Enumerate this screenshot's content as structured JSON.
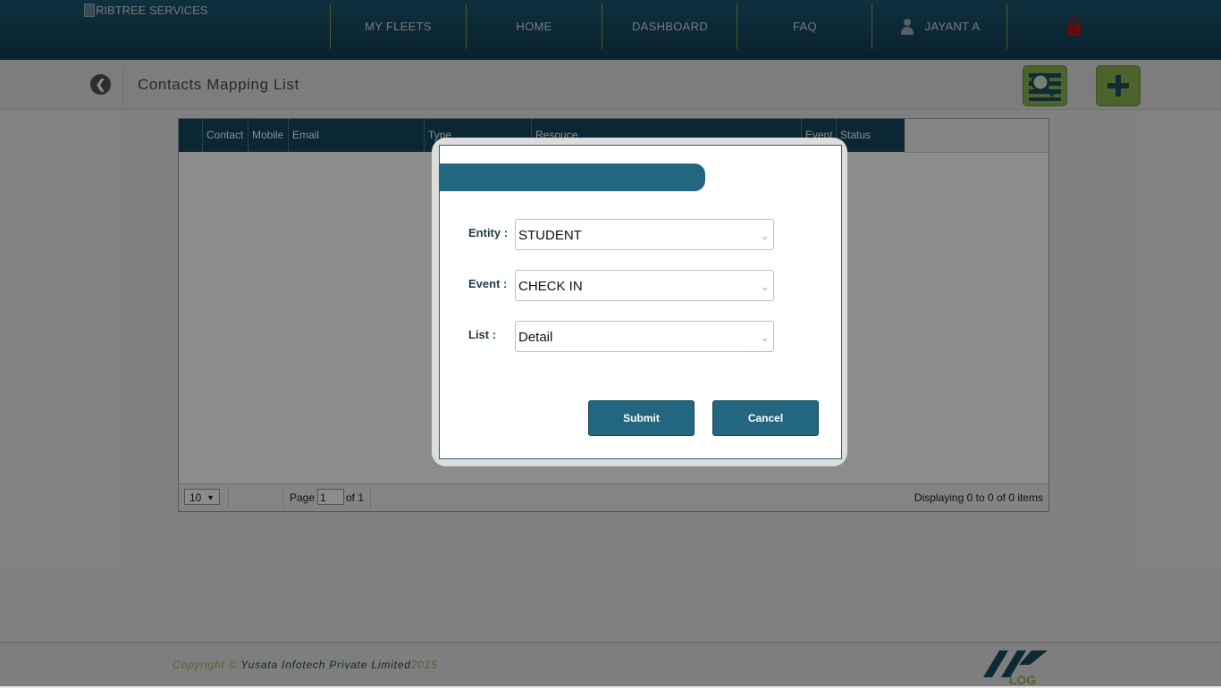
{
  "brand": {
    "logo_alt": "RIBTREE SERVICES"
  },
  "nav": {
    "items": [
      {
        "label": "MY FLEETS"
      },
      {
        "label": "HOME"
      },
      {
        "label": "DASHBOARD"
      },
      {
        "label": "FAQ"
      }
    ],
    "user_name": "JAYANT A"
  },
  "subheader": {
    "title": "Contacts Mapping List"
  },
  "grid": {
    "columns": [
      "Contact",
      "Mobile",
      "Email",
      "Type",
      "Resouce",
      "Event",
      "Status"
    ],
    "rows": [],
    "footer": {
      "page_size": "10",
      "page_label": "Page",
      "page_value": "1",
      "of_label": "of 1",
      "display_text": "Displaying 0 to 0 of 0 items"
    }
  },
  "dialog": {
    "title": "",
    "fields": {
      "entity": {
        "label": "Entity :",
        "value": "STUDENT"
      },
      "event": {
        "label": "Event :",
        "value": "CHECK IN"
      },
      "list": {
        "label": "List :",
        "value": "Detail"
      }
    },
    "submit_label": "Submit",
    "cancel_label": "Cancel"
  },
  "footer": {
    "copyright_prefix": "Copyright ©",
    "company": "Yusata Infotech Private Limited",
    "year": "2015",
    "logo_text": "LOG"
  },
  "colors": {
    "nav_bg": "#15475e",
    "accent": "#236680",
    "action_green": "#8cb550",
    "lock_red": "#c0141b",
    "copyright_green": "#9ab24f"
  },
  "icons": [
    "user-icon",
    "lock-icon",
    "back-arrow-icon",
    "search-list-icon",
    "plus-icon",
    "chevron-down-icon"
  ]
}
